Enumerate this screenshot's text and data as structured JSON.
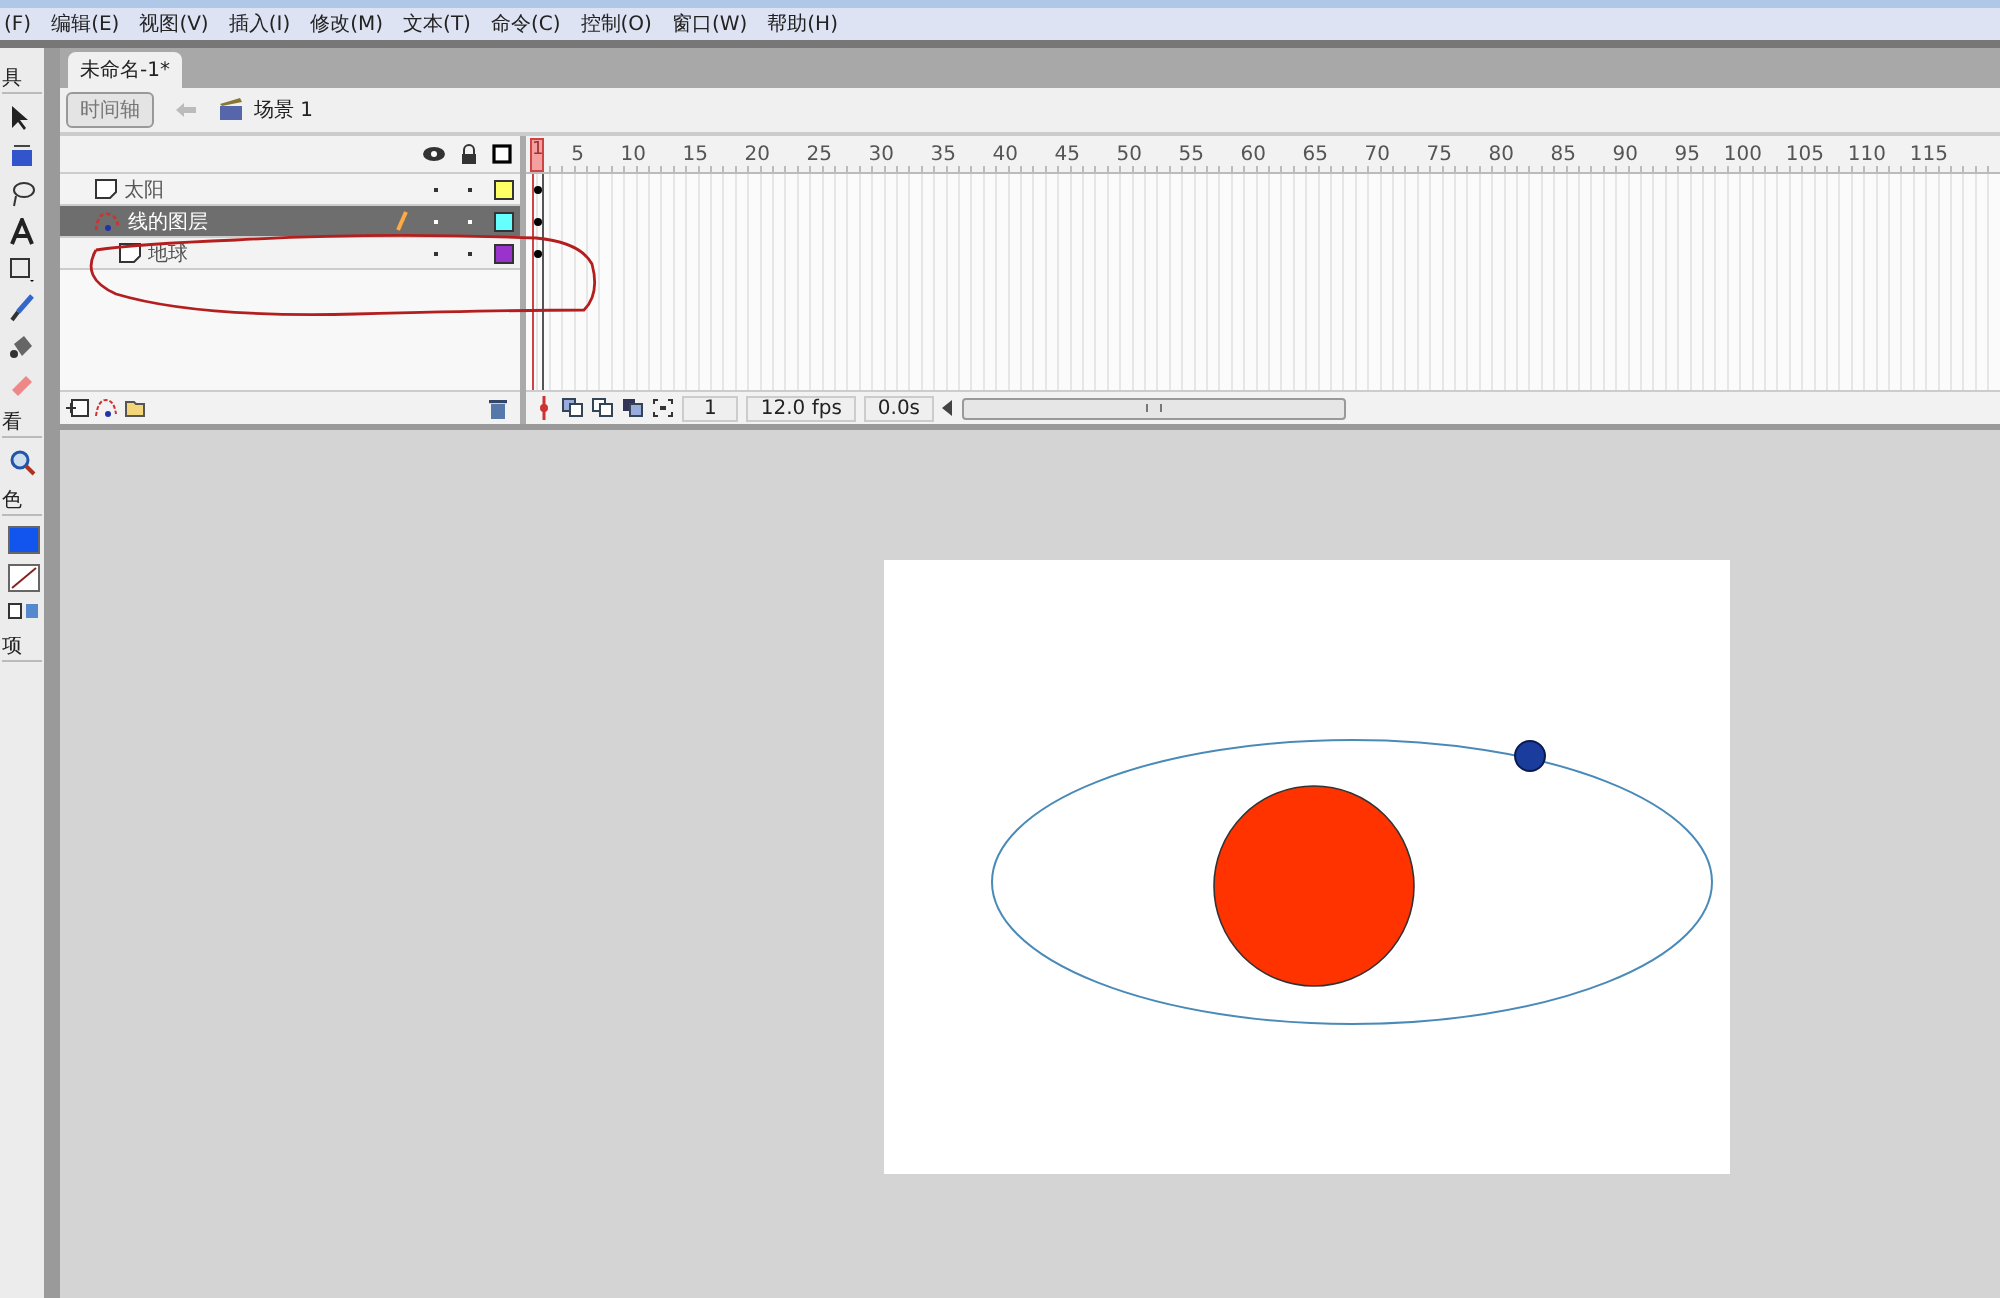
{
  "menu": [
    "(F)",
    "编辑(E)",
    "视图(V)",
    "插入(I)",
    "修改(M)",
    "文本(T)",
    "命令(C)",
    "控制(O)",
    "窗口(W)",
    "帮助(H)"
  ],
  "tools_panel": {
    "headings": [
      "具",
      "看",
      "色",
      "项"
    ]
  },
  "document_tab": {
    "label": "未命名-1*",
    "selected": true
  },
  "edit_bar": {
    "timeline_button": "时间轴",
    "scene": "场景 1"
  },
  "timeline": {
    "frame_numbers": [
      "1",
      "5",
      "10",
      "15",
      "20",
      "25",
      "30",
      "35",
      "40",
      "45",
      "50",
      "55",
      "60",
      "65",
      "70",
      "75",
      "80",
      "85",
      "90",
      "95",
      "100",
      "105",
      "110",
      "115"
    ],
    "layers": [
      {
        "name": "太阳",
        "kind": "normal",
        "selected": false,
        "color": "#ffff66"
      },
      {
        "name": "线的图层",
        "kind": "guide",
        "selected": true,
        "color": "#66ffff",
        "children": [
          {
            "name": "地球",
            "kind": "normal",
            "selected": false,
            "color": "#9933cc"
          }
        ]
      }
    ],
    "status": {
      "frame": "1",
      "fps": "12.0 fps",
      "time": "0.0s"
    }
  },
  "annotation": {
    "kind": "freehand-loop"
  }
}
